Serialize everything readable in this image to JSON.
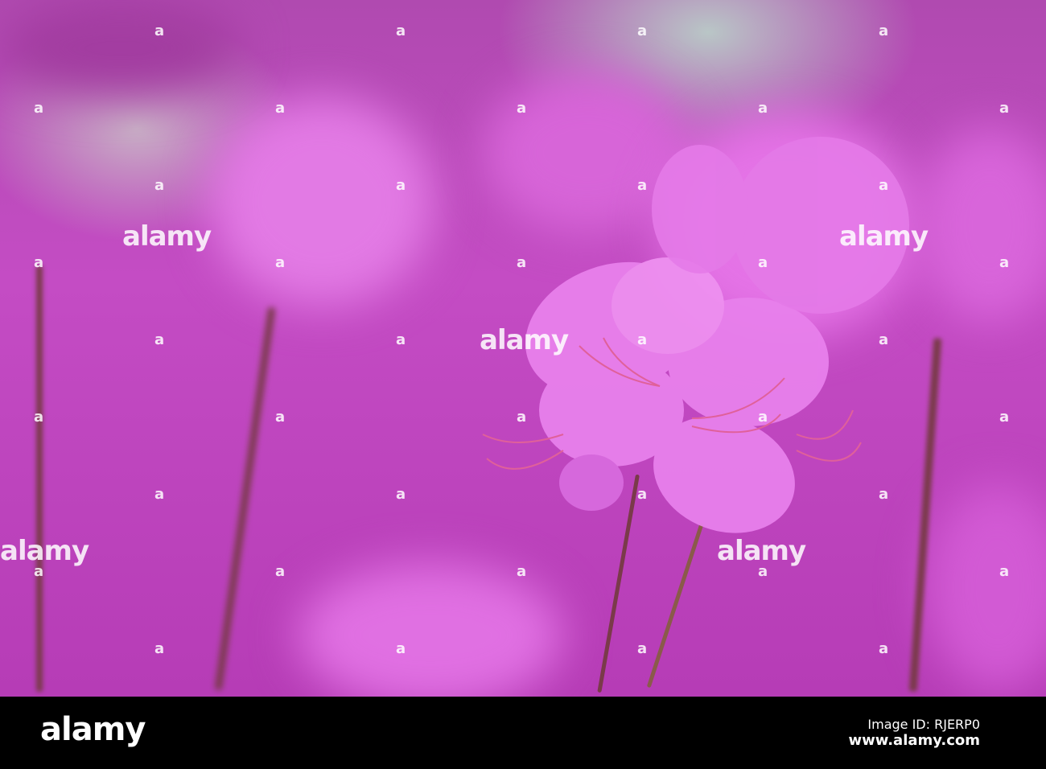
{
  "image": {
    "subject": "pink rhododendron flower",
    "palette": {
      "magenta": "#c44cc4",
      "flower": "#e070e0",
      "stem": "#7a3a4a"
    }
  },
  "watermark": {
    "small_text": "a",
    "big_text": "alamy"
  },
  "footer": {
    "logo": "alamy",
    "image_id": "Image ID: RJERP0",
    "url": "www.alamy.com"
  }
}
